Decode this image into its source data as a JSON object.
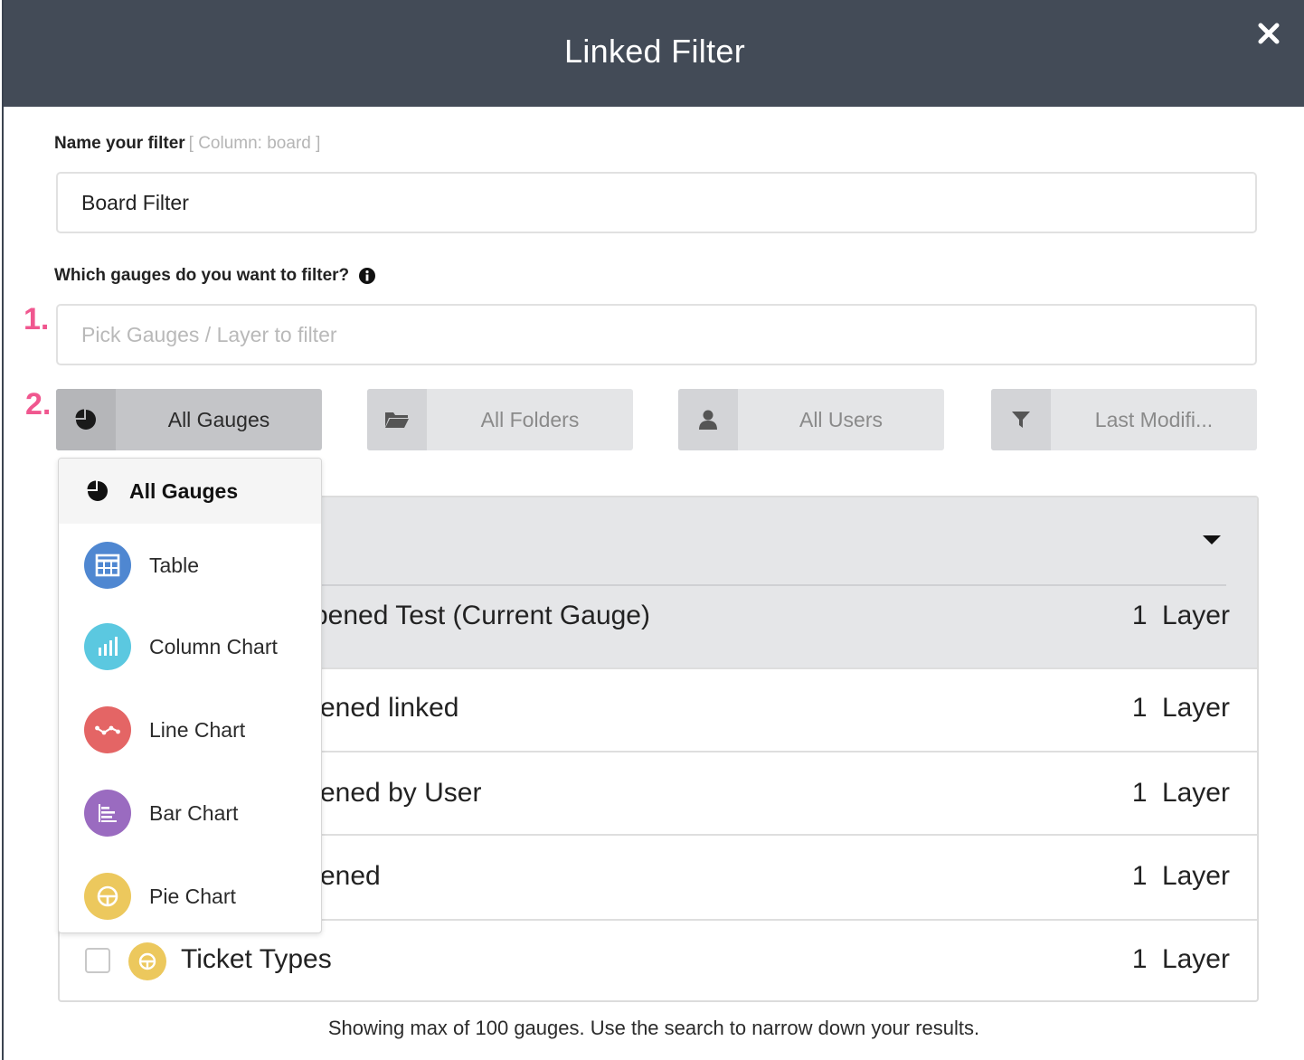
{
  "dialog": {
    "title": "Linked Filter"
  },
  "name_field": {
    "label": "Name your filter",
    "hint": "[ Column: board ]",
    "value": "Board Filter"
  },
  "gauges_field": {
    "label": "Which gauges do you want to filter?",
    "placeholder": "Pick Gauges / Layer to filter"
  },
  "steps": {
    "one": "1.",
    "two": "2."
  },
  "filters": {
    "gauges": "All Gauges",
    "folders": "All Folders",
    "users": "All Users",
    "modified": "Last Modifi..."
  },
  "dropdown": {
    "items": [
      {
        "label": "All Gauges",
        "icon": "pie-icon"
      },
      {
        "label": "Table",
        "icon": "table-icon",
        "color": "#4f87d1"
      },
      {
        "label": "Column Chart",
        "icon": "column-chart-icon",
        "color": "#5bc8e0"
      },
      {
        "label": "Line Chart",
        "icon": "line-chart-icon",
        "color": "#e46565"
      },
      {
        "label": "Bar Chart",
        "icon": "bar-chart-icon",
        "color": "#9a6bc0"
      },
      {
        "label": "Pie Chart",
        "icon": "pie-chart-icon",
        "color": "#ecc85d"
      }
    ]
  },
  "table": {
    "rows": [
      {
        "name": "Opened Test (Current Gauge)",
        "layers": "1 Layer"
      },
      {
        "name": "Opened linked",
        "layers": "1 Layer"
      },
      {
        "name": "Opened by User",
        "layers": "1 Layer"
      },
      {
        "name": "Opened",
        "layers": "1 Layer"
      },
      {
        "name": "Ticket Types",
        "layers": "1 Layer"
      }
    ],
    "visible_fragments": [
      ")pened Test (Current Gauge)",
      "ened linked",
      "ened by User",
      "ened",
      "Ticket Types"
    ]
  },
  "footer": {
    "text": "Showing max of 100 gauges. Use the search to narrow down your results."
  },
  "colors": {
    "header_bg": "#434b57",
    "accent_step": "#f0578f"
  }
}
